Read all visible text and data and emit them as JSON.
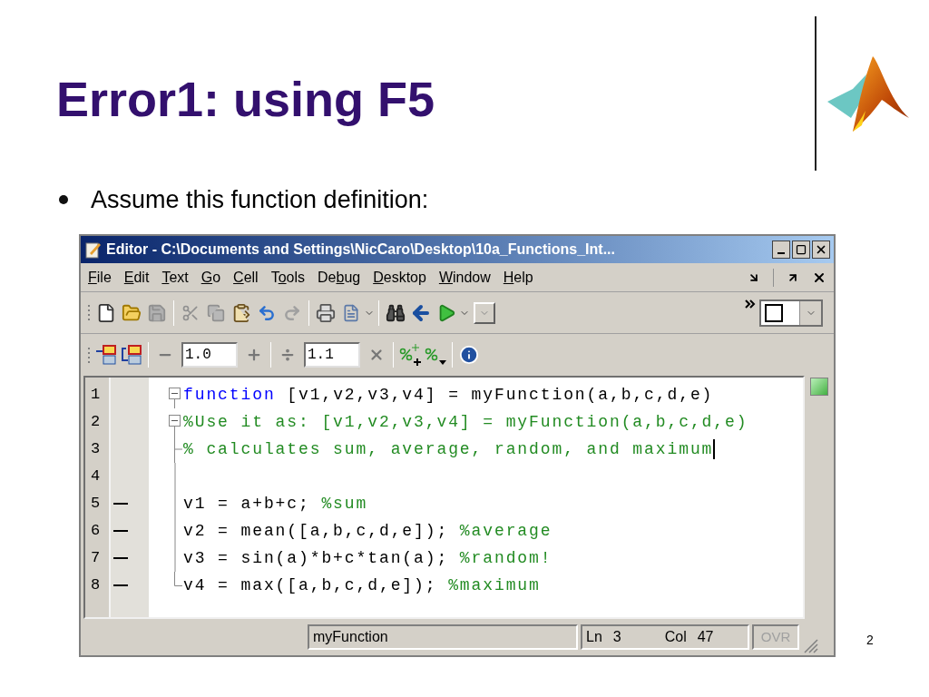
{
  "slide": {
    "title": "Error1: using F5",
    "bullet": "Assume this function definition:",
    "page_number": "2"
  },
  "editor": {
    "title": "Editor - C:\\Documents and Settings\\NicCaro\\Desktop\\10a_Functions_Int...",
    "menu": [
      {
        "key": "F",
        "post": "ile"
      },
      {
        "key": "E",
        "post": "dit"
      },
      {
        "key": "T",
        "post": "ext"
      },
      {
        "key": "G",
        "post": "o"
      },
      {
        "key": "C",
        "post": "ell"
      },
      {
        "pre": "T",
        "key": "o",
        "post": "ols"
      },
      {
        "pre": "De",
        "key": "b",
        "post": "ug"
      },
      {
        "key": "D",
        "post": "esktop"
      },
      {
        "key": "W",
        "post": "indow"
      },
      {
        "key": "H",
        "post": "elp"
      }
    ],
    "toolbar2": {
      "step_value": "1.0",
      "scale_value": "1.1"
    },
    "lines": [
      {
        "number": "1",
        "executable": false,
        "fold": {
          "kind": "open"
        },
        "segments": [
          {
            "kind": "keyword",
            "text": "function"
          },
          {
            "kind": "code",
            "text": " [v1,v2,v3,v4] = myFunction(a,b,c,d,e)"
          }
        ]
      },
      {
        "number": "2",
        "executable": false,
        "fold": {
          "kind": "open"
        },
        "segments": [
          {
            "kind": "comment",
            "text": "%Use it as: [v1,v2,v3,v4] = myFunction(a,b,c,d,e)"
          }
        ]
      },
      {
        "number": "3",
        "executable": false,
        "fold": {
          "kind": "branch"
        },
        "cursor": true,
        "segments": [
          {
            "kind": "comment",
            "text": "% calculates sum, average, random, and maximum"
          }
        ]
      },
      {
        "number": "4",
        "executable": false,
        "fold": {
          "kind": "line"
        }
      },
      {
        "number": "5",
        "executable": true,
        "fold": {
          "kind": "line"
        },
        "segments": [
          {
            "kind": "code",
            "text": "v1 = a+b+c; "
          },
          {
            "kind": "comment",
            "text": "%sum"
          }
        ]
      },
      {
        "number": "6",
        "executable": true,
        "fold": {
          "kind": "line"
        },
        "segments": [
          {
            "kind": "code",
            "text": "v2 = mean([a,b,c,d,e]); "
          },
          {
            "kind": "comment",
            "text": "%average"
          }
        ]
      },
      {
        "number": "7",
        "executable": true,
        "fold": {
          "kind": "line"
        },
        "segments": [
          {
            "kind": "code",
            "text": "v3 = sin(a)*b+c*tan(a); "
          },
          {
            "kind": "comment",
            "text": "%random!"
          }
        ]
      },
      {
        "number": "8",
        "executable": true,
        "fold": {
          "kind": "end"
        },
        "segments": [
          {
            "kind": "code",
            "text": "v4 = max([a,b,c,d,e]); "
          },
          {
            "kind": "comment",
            "text": "%maximum"
          }
        ]
      }
    ],
    "status_bar": {
      "function": "myFunction",
      "ln_label": "Ln",
      "ln": "3",
      "col_label": "Col",
      "col": "47",
      "ovr": "OVR",
      "ovr_disabled": true
    }
  }
}
